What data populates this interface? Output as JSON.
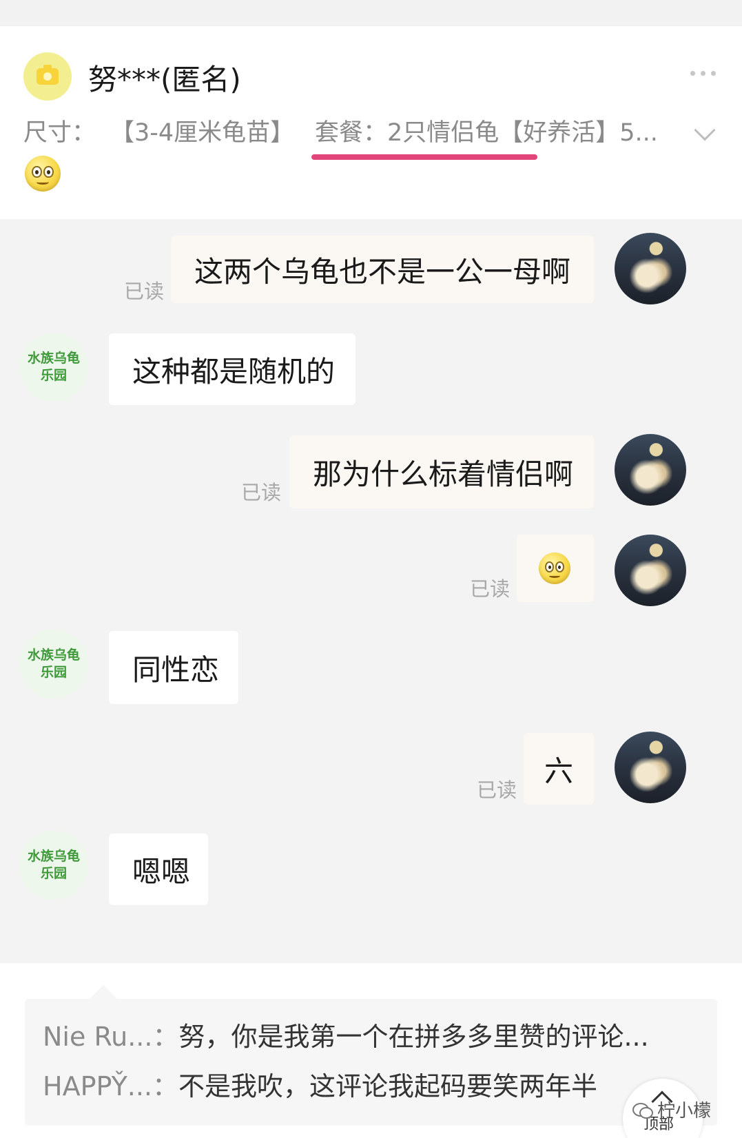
{
  "header": {
    "username": "努***(匿名)",
    "spec_size_label": "尺寸：",
    "spec_size_value": "【3-4厘米龟苗】",
    "spec_package": "套餐：2只情侣龟【好养活】5...",
    "accent_color": "#e1457a"
  },
  "chat": {
    "shop_avatar_line1": "水族乌龟",
    "shop_avatar_line2": "乐园",
    "read_label": "已读",
    "messages": [
      {
        "side": "right",
        "text": "这两个乌龟也不是一公一母啊",
        "read": "已读"
      },
      {
        "side": "left",
        "text": "这种都是随机的"
      },
      {
        "side": "right",
        "text": "那为什么标着情侣啊",
        "read": "已读"
      },
      {
        "side": "right",
        "emoji": "smiley-emoji",
        "read": "已读"
      },
      {
        "side": "left",
        "text": "同性恋"
      },
      {
        "side": "right",
        "text": "六",
        "read": "已读"
      },
      {
        "side": "left",
        "text": "嗯嗯"
      }
    ]
  },
  "comments": [
    {
      "author": "Nie Ru...：",
      "text": "努，你是我第一个在拼多多里赞的评论..."
    },
    {
      "author": "HAPPY̌...：",
      "text": "不是我吹，这评论我起码要笑两年半"
    }
  ],
  "top_button": {
    "label": "顶部"
  },
  "watermark": {
    "text": "柠小檬"
  }
}
